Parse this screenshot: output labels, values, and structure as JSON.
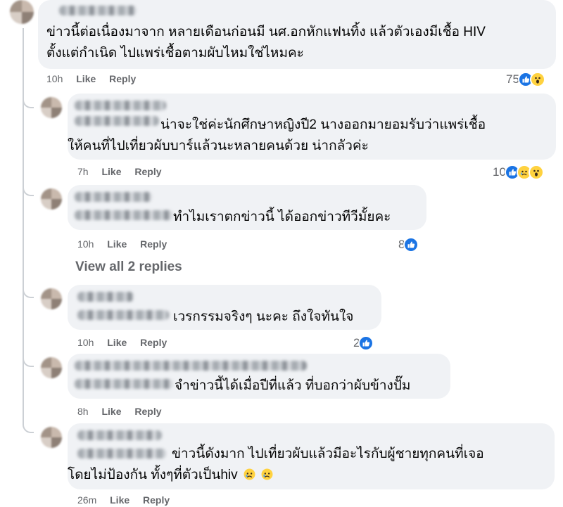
{
  "comments": [
    {
      "text_lines": [
        "ข่าวนี้ต่อเนื่องมาจาก หลายเดือนก่อนมี นศ.อกหักแฟนทิ้ง แล้วตัวเองมีเชื้อ HIV",
        "ตั้งแต่กำเนิด ไปแพร่เชื้อตามผับไหมใช่ไหมคะ"
      ],
      "time": "10h",
      "like": "Like",
      "reply": "Reply",
      "reaction_count": "75",
      "reactions": [
        "like",
        "wow"
      ]
    },
    {
      "text_lines": [
        "น่าจะใช่ค่ะนักศึกษาหญิงปี2 นางออกมายอมรับว่าแพร่เชื้อ",
        "ให้คนที่ไปเที่ยวผับบาร์แล้วนะหลายคนด้วย น่ากลัวค่ะ"
      ],
      "time": "7h",
      "like": "Like",
      "reply": "Reply",
      "reaction_count": "10",
      "reactions": [
        "like",
        "sad",
        "wow"
      ]
    },
    {
      "text_lines": [
        "ทำไมเราตกข่าวนี้ ได้ออกข่าวทีวีมั้ยคะ"
      ],
      "time": "10h",
      "like": "Like",
      "reply": "Reply",
      "reaction_count": "8",
      "reactions": [
        "like"
      ]
    },
    {
      "text_lines": [
        "เวรกรรมจริงๆ นะคะ ถึงใจทันใจ"
      ],
      "time": "10h",
      "like": "Like",
      "reply": "Reply",
      "reaction_count": "2",
      "reactions": [
        "like"
      ]
    },
    {
      "text_lines": [
        "จำข่าวนี้ได้เมื่อปีที่แล้ว ที่บอกว่าผับข้างปั๊ม"
      ],
      "time": "8h",
      "like": "Like",
      "reply": "Reply",
      "reaction_count": "",
      "reactions": []
    },
    {
      "text_lines": [
        "ข่าวนี้ดังมาก ไปเที่ยวผับแล้วมีอะไรกับผู้ชายทุกคนที่เจอ",
        "โดยไม่ป้องกัน ทั้งๆที่ตัวเป็นhiv"
      ],
      "inline_emojis": [
        "sad-face",
        "sad-face"
      ],
      "time": "26m",
      "like": "Like",
      "reply": "Reply",
      "reaction_count": "",
      "reactions": []
    }
  ],
  "view_all_replies": "View all 2 replies",
  "colors": {
    "bubble": "#f0f2f5",
    "meta": "#65676b",
    "like_blue": "#1b74e4",
    "emoji_yellow": "#ffd23f"
  }
}
